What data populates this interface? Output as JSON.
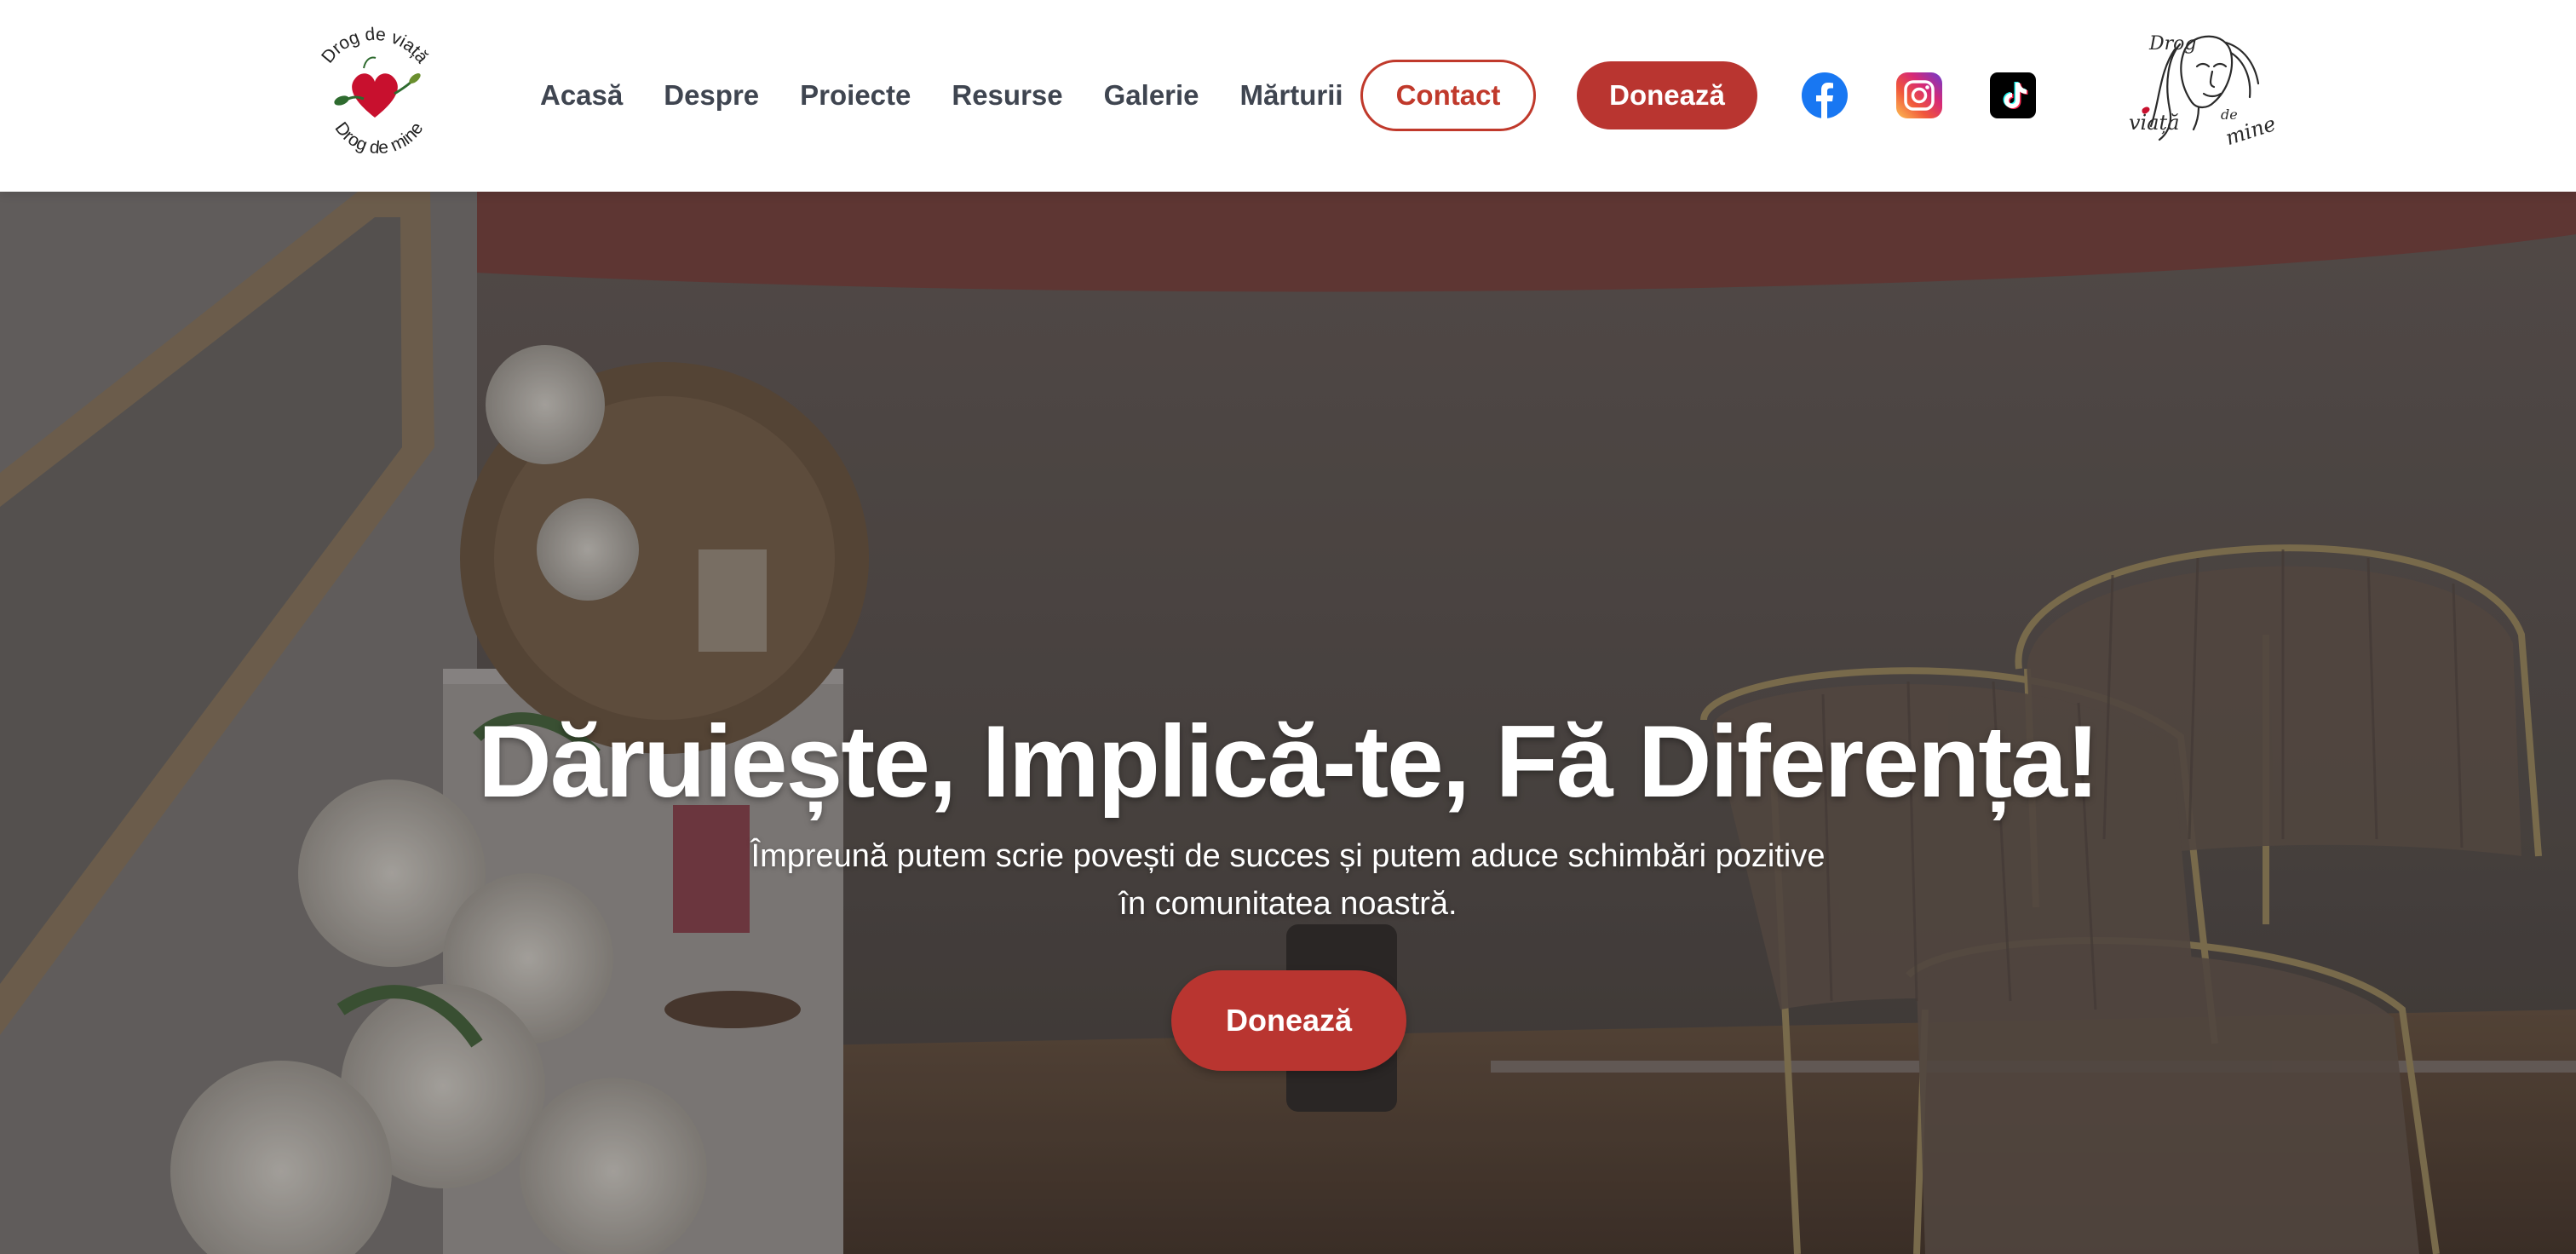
{
  "header": {
    "logo_left": {
      "top_text": "Drog de viață",
      "bottom_text": "Drog de mine"
    },
    "nav": [
      {
        "label": "Acasă"
      },
      {
        "label": "Despre"
      },
      {
        "label": "Proiecte"
      },
      {
        "label": "Resurse"
      },
      {
        "label": "Galerie"
      },
      {
        "label": "Mărturii"
      }
    ],
    "contact_label": "Contact",
    "donate_label": "Donează",
    "social": [
      {
        "icon": "facebook-icon"
      },
      {
        "icon": "instagram-icon"
      },
      {
        "icon": "tiktok-icon"
      }
    ],
    "logo_right": {
      "word1": "Drog",
      "word2": "de",
      "word3": "viață",
      "word4": "mine"
    }
  },
  "hero": {
    "title": "Dăruiește, Implică-te, Fă Diferența!",
    "subtitle_line1": "Împreună putem scrie povești de succes și putem aduce schimbări pozitive",
    "subtitle_line2": "în comunitatea noastră.",
    "donate_label": "Donează"
  },
  "colors": {
    "accent": "#b93530",
    "nav_text": "#3f4550",
    "facebook": "#1877f2",
    "white": "#ffffff"
  }
}
